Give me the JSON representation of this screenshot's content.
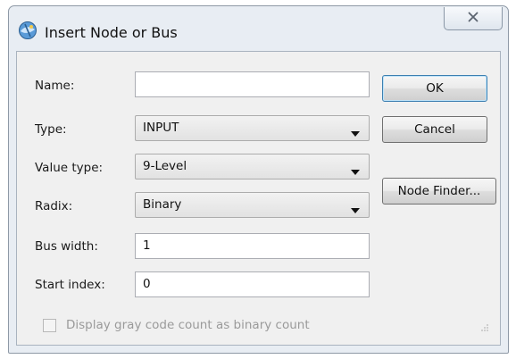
{
  "window": {
    "title": "Insert Node or Bus",
    "close_icon": "close-icon"
  },
  "form": {
    "name_label": "Name:",
    "name_value": "",
    "type_label": "Type:",
    "type_value": "INPUT",
    "value_type_label": "Value type:",
    "value_type_value": "9-Level",
    "radix_label": "Radix:",
    "radix_value": "Binary",
    "bus_width_label": "Bus width:",
    "bus_width_value": "1",
    "start_index_label": "Start index:",
    "start_index_value": "0",
    "gray_code_label": "Display gray code count as binary count",
    "gray_code_checked": false,
    "gray_code_enabled": false
  },
  "buttons": {
    "ok": "OK",
    "cancel": "Cancel",
    "node_finder": "Node Finder..."
  },
  "colors": {
    "frame": "#e8edf3",
    "client": "#f0f0f0",
    "disabled_text": "#9a9a9a"
  }
}
